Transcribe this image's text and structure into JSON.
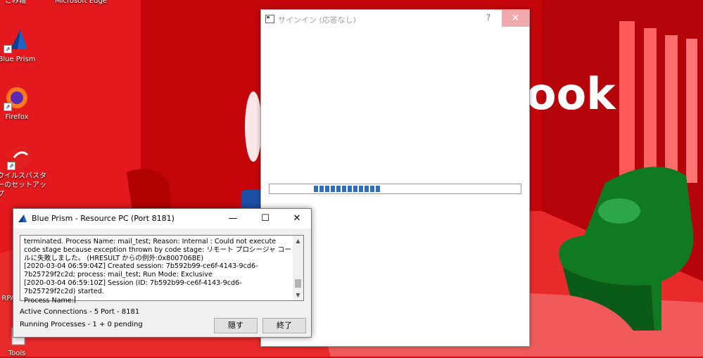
{
  "desktop": {
    "icons": [
      {
        "label": "ごみ箱"
      },
      {
        "label": "Microsoft Edge"
      },
      {
        "label": "Blue Prism"
      },
      {
        "label": "Firefox"
      },
      {
        "label": "ウイルスバスターのセットアップ"
      },
      {
        "label": "RPA"
      },
      {
        "label": "Tools"
      }
    ],
    "wallpaper_text": "ook",
    "colors": {
      "wallpaper_red": "#d40d12",
      "chair_green": "#1a8a2a"
    }
  },
  "signin_window": {
    "title": "サインイン (応答なし)",
    "help_label": "?",
    "close_label": "✕",
    "progress_segments": 12
  },
  "blueprism_window": {
    "title": "Blue Prism - Resource PC (Port 8181)",
    "minimize_label": "—",
    "maximize_label": "☐",
    "close_label": "✕",
    "log_text": "terminated. Process Name: mail_test; Reason: Internal : Could not execute code stage because exception thrown by code stage: リモート プロシージャ コールに失敗しました。 (HRESULT からの例外:0x800706BE)\n[2020-03-04 06:59:04Z] Created session: 7b592b99-ce6f-4143-9cd6-7b25729f2c2d; process: mail_test; Run Mode: Exclusive\n[2020-03-04 06:59:10Z] Session (ID: 7b592b99-ce6f-4143-9cd6-7b25729f2c2d) started.\nProcess Name:",
    "active_connections": "Active Connections - 5",
    "port": "Port - 8181",
    "running_processes": "Running Processes - 1 + 0 pending",
    "hide_button": "隠す",
    "exit_button": "終了",
    "accent_color": "#1e64c8"
  }
}
